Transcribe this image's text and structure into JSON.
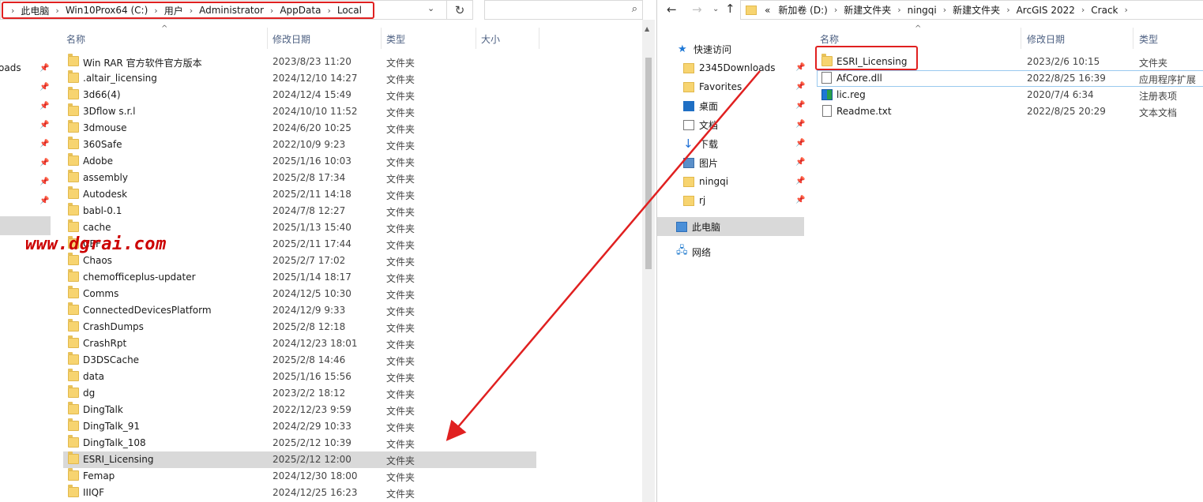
{
  "left": {
    "address": [
      "此电脑",
      "Win10Prox64 (C:)",
      "用户",
      "Administrator",
      "AppData",
      "Local"
    ],
    "headers": {
      "name": "名称",
      "date": "修改日期",
      "type": "类型",
      "size": "大小"
    },
    "nav_fragment": "oads",
    "rows": [
      {
        "name": "Win RAR 官方软件官方版本",
        "date": "2023/8/23 11:20",
        "type": "文件夹"
      },
      {
        "name": ".altair_licensing",
        "date": "2024/12/10 14:27",
        "type": "文件夹"
      },
      {
        "name": "3d66(4)",
        "date": "2024/12/4 15:49",
        "type": "文件夹"
      },
      {
        "name": "3Dflow s.r.l",
        "date": "2024/10/10 11:52",
        "type": "文件夹"
      },
      {
        "name": "3dmouse",
        "date": "2024/6/20 10:25",
        "type": "文件夹"
      },
      {
        "name": "360Safe",
        "date": "2022/10/9 9:23",
        "type": "文件夹"
      },
      {
        "name": "Adobe",
        "date": "2025/1/16 10:03",
        "type": "文件夹"
      },
      {
        "name": "assembly",
        "date": "2025/2/8 17:34",
        "type": "文件夹"
      },
      {
        "name": "Autodesk",
        "date": "2025/2/11 14:18",
        "type": "文件夹"
      },
      {
        "name": "babl-0.1",
        "date": "2024/7/8 12:27",
        "type": "文件夹"
      },
      {
        "name": "cache",
        "date": "2025/1/13 15:40",
        "type": "文件夹"
      },
      {
        "name": "CEF",
        "date": "2025/2/11 17:44",
        "type": "文件夹"
      },
      {
        "name": "Chaos",
        "date": "2025/2/7 17:02",
        "type": "文件夹"
      },
      {
        "name": "chemofficeplus-updater",
        "date": "2025/1/14 18:17",
        "type": "文件夹"
      },
      {
        "name": "Comms",
        "date": "2024/12/5 10:30",
        "type": "文件夹"
      },
      {
        "name": "ConnectedDevicesPlatform",
        "date": "2024/12/9 9:33",
        "type": "文件夹"
      },
      {
        "name": "CrashDumps",
        "date": "2025/2/8 12:18",
        "type": "文件夹"
      },
      {
        "name": "CrashRpt",
        "date": "2024/12/23 18:01",
        "type": "文件夹"
      },
      {
        "name": "D3DSCache",
        "date": "2025/2/8 14:46",
        "type": "文件夹"
      },
      {
        "name": "data",
        "date": "2025/1/16 15:56",
        "type": "文件夹"
      },
      {
        "name": "dg",
        "date": "2023/2/2 18:12",
        "type": "文件夹"
      },
      {
        "name": "DingTalk",
        "date": "2022/12/23 9:59",
        "type": "文件夹"
      },
      {
        "name": "DingTalk_91",
        "date": "2024/2/29 10:33",
        "type": "文件夹"
      },
      {
        "name": "DingTalk_108",
        "date": "2025/2/12 10:39",
        "type": "文件夹"
      },
      {
        "name": "ESRI_Licensing",
        "date": "2025/2/12 12:00",
        "type": "文件夹",
        "selected": true
      },
      {
        "name": "Femap",
        "date": "2024/12/30 18:00",
        "type": "文件夹"
      },
      {
        "name": "IIIQF",
        "date": "2024/12/25 16:23",
        "type": "文件夹"
      }
    ]
  },
  "watermark": "www.dgrai.com",
  "right": {
    "address": [
      "新加卷 (D:)",
      "新建文件夹",
      "ningqi",
      "新建文件夹",
      "ArcGIS 2022",
      "Crack"
    ],
    "address_prefix": "«",
    "headers": {
      "name": "名称",
      "date": "修改日期",
      "type": "类型"
    },
    "nav": [
      {
        "label": "快速访问",
        "icon": "star-icon"
      },
      {
        "label": "2345Downloads",
        "icon": "folder-icon"
      },
      {
        "label": "Favorites",
        "icon": "folder-icon"
      },
      {
        "label": "桌面",
        "icon": "desktop-icon"
      },
      {
        "label": "文档",
        "icon": "document-icon"
      },
      {
        "label": "下载",
        "icon": "download-icon"
      },
      {
        "label": "图片",
        "icon": "pictures-icon"
      },
      {
        "label": "ningqi",
        "icon": "folder-icon"
      },
      {
        "label": "rj",
        "icon": "folder-icon"
      },
      {
        "label": "此电脑",
        "icon": "computer-icon"
      },
      {
        "label": "网络",
        "icon": "network-icon"
      }
    ],
    "rows": [
      {
        "name": "ESRI_Licensing",
        "date": "2023/2/6 10:15",
        "type": "文件夹",
        "icon": "folder-icon"
      },
      {
        "name": "AfCore.dll",
        "date": "2022/8/25 16:39",
        "type": "应用程序扩展",
        "icon": "dll-file-icon"
      },
      {
        "name": "lic.reg",
        "date": "2020/7/4 6:34",
        "type": "注册表项",
        "icon": "registry-file-icon"
      },
      {
        "name": "Readme.txt",
        "date": "2022/8/25 20:29",
        "type": "文本文档",
        "icon": "text-file-icon"
      }
    ]
  },
  "colors": {
    "highlight": "#e02020",
    "selection": "#d9d9d9",
    "header_text": "#4d6082",
    "folder": "#f7d470"
  }
}
